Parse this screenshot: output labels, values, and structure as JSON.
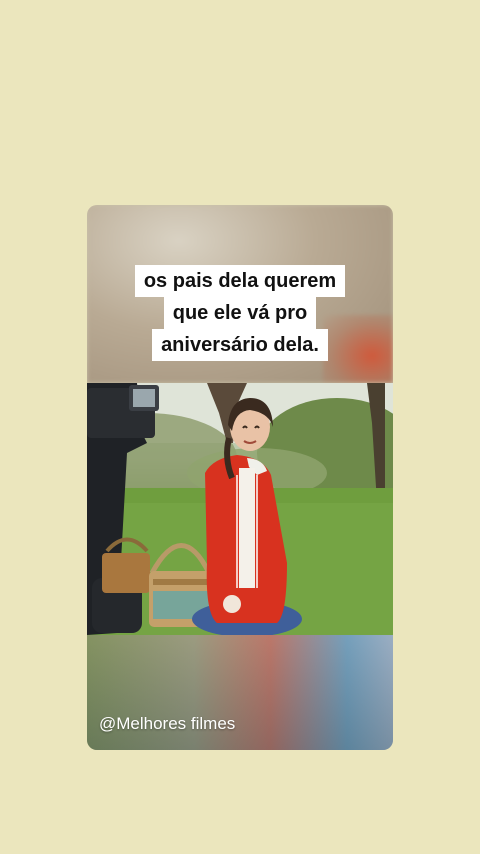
{
  "post": {
    "caption_lines": [
      "os pais dela querem",
      "que ele vá pro",
      "aniversário dela."
    ],
    "watermark": "@Melhores filmes"
  },
  "colors": {
    "page_background": "#ebe6bd",
    "caption_background": "#ffffff",
    "caption_text": "#111111",
    "jacket_red": "#d8321f"
  }
}
